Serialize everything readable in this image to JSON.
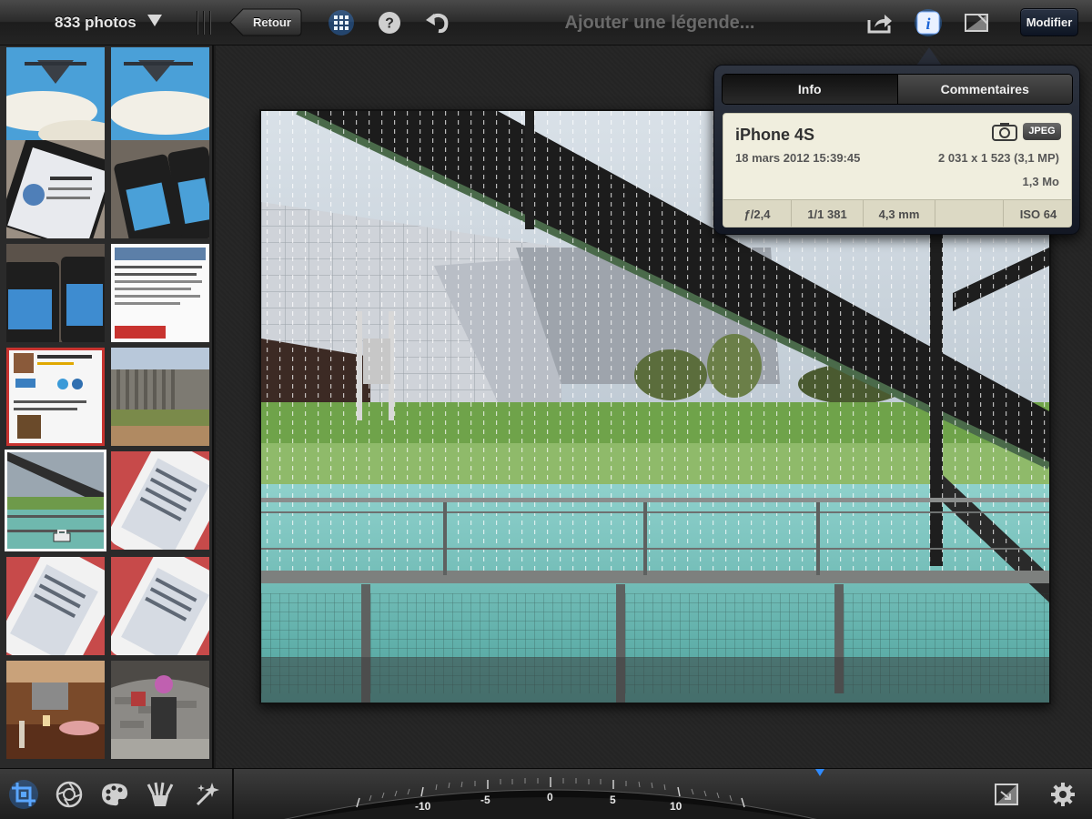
{
  "colors": {
    "accent_blue": "#2f8bff",
    "edit_button": "#1a2233",
    "info_card": "#f0eede"
  },
  "sidebar_header": {
    "photo_count": "833 photos",
    "dropdown_icon": "triangle-down-icon"
  },
  "toolbar": {
    "back_label": "Retour",
    "grid_icon": "grid-icon",
    "help_icon": "question-icon",
    "undo_icon": "undo-icon",
    "caption_placeholder": "Ajouter une légende...",
    "share_icon": "share-icon",
    "info_icon": "info-icon",
    "compare_icon": "compare-icon",
    "edit_label": "Modifier"
  },
  "info_popover": {
    "tabs": [
      "Info",
      "Commentaires"
    ],
    "active_tab": "Info",
    "device": "iPhone 4S",
    "date": "18 mars 2012 15:39:45",
    "resolution": "2 031 x 1 523 (3,1 MP)",
    "file_size": "1,3 Mo",
    "format": "JPEG",
    "exif": {
      "aperture": "ƒ/2,4",
      "shutter": "1/1 381",
      "focal_length": "4,3 mm",
      "empty": "",
      "iso": "ISO 64"
    }
  },
  "thumbnails": [
    {
      "subject": "aircraft-over-clouds"
    },
    {
      "subject": "aircraft-over-clouds"
    },
    {
      "subject": "ipad-screen-ios5"
    },
    {
      "subject": "ipad-screen-accueil"
    },
    {
      "subject": "ipad-press-screen"
    },
    {
      "subject": "article-ipad-wifi-4g"
    },
    {
      "subject": "app-store-page"
    },
    {
      "subject": "sculpture-garden"
    },
    {
      "subject": "fountain-rain-wall",
      "selected": true
    },
    {
      "subject": "iphone-settings-red"
    },
    {
      "subject": "iphone-settings-red"
    },
    {
      "subject": "iphone-settings-red"
    },
    {
      "subject": "restaurant-interior"
    },
    {
      "subject": "stone-cottage"
    }
  ],
  "bottom_tools": [
    "crop-icon",
    "exposure-icon",
    "palette-icon",
    "brush-icon",
    "effects-icon"
  ],
  "bottom_right": [
    "auto-enhance-icon",
    "settings-gear-icon"
  ],
  "straighten_dial": {
    "labels": [
      "-10",
      "-5",
      "0",
      "5",
      "10"
    ],
    "current_value": "0"
  }
}
